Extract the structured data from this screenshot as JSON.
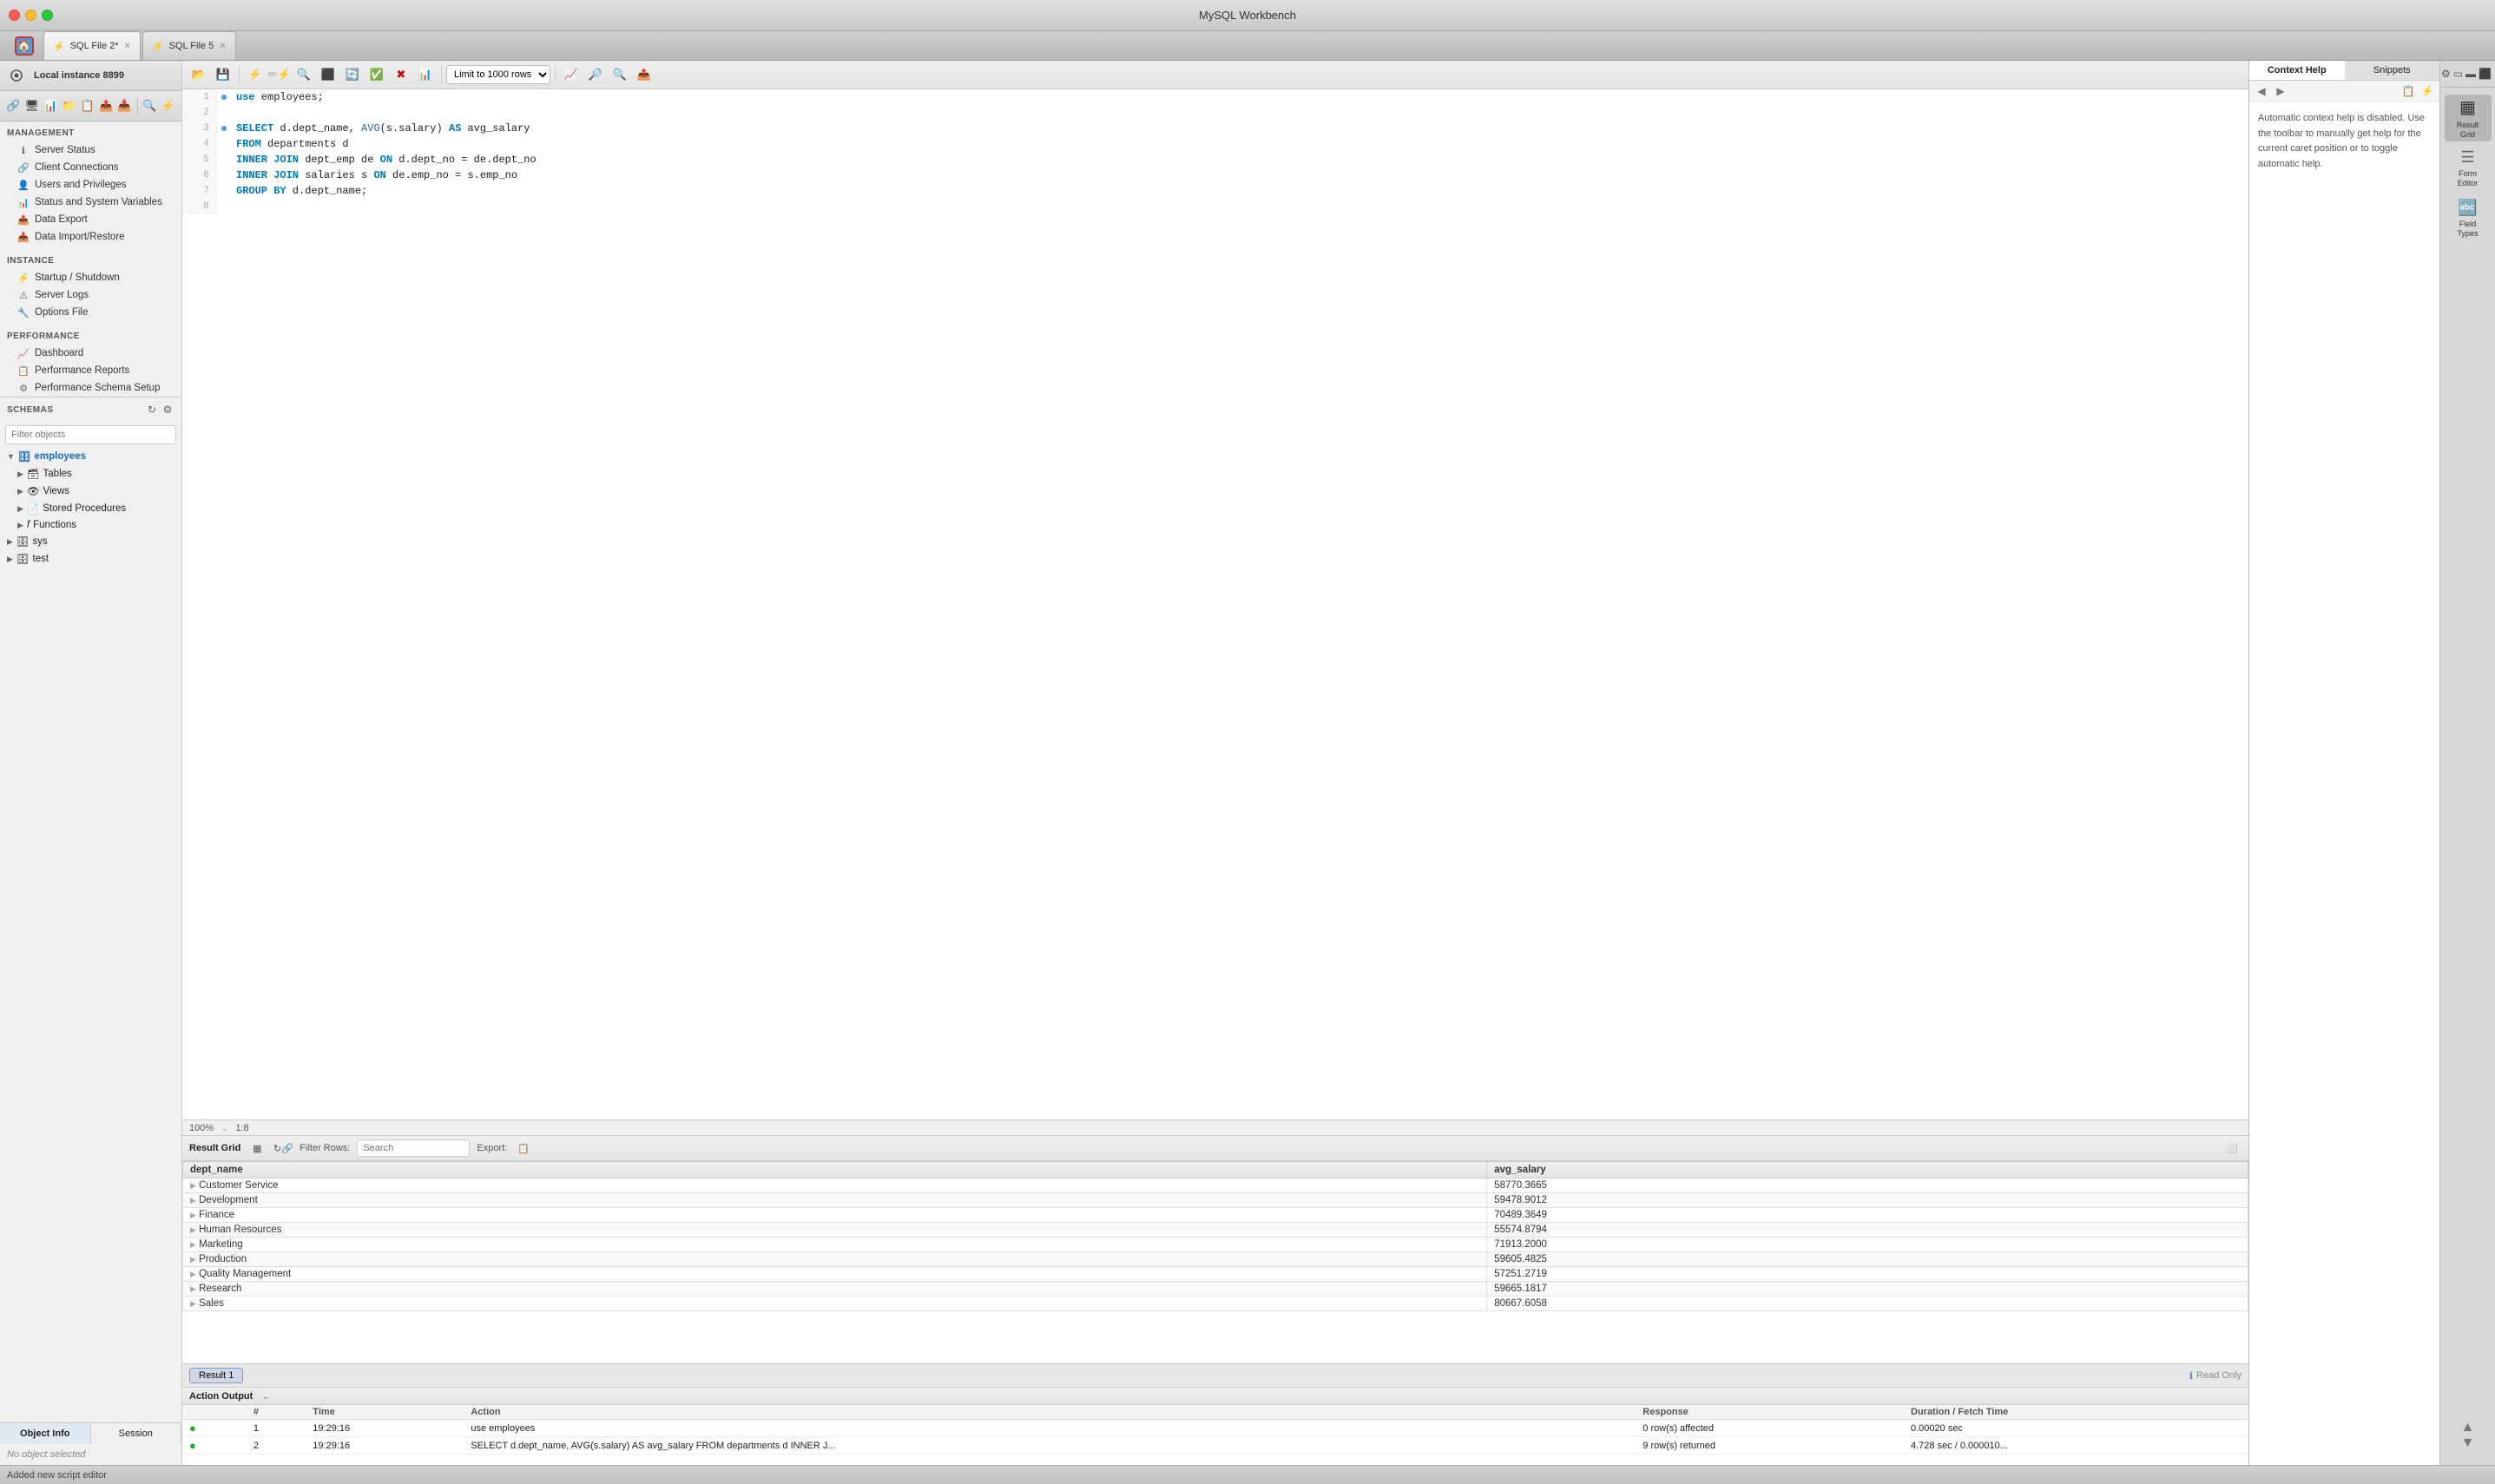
{
  "app": {
    "title": "MySQL Workbench"
  },
  "titlebar": {
    "title": "MySQL Workbench"
  },
  "tabs": {
    "home": "🏠",
    "items": [
      {
        "label": "SQL File 2*",
        "active": true,
        "icon": "⚡"
      },
      {
        "label": "SQL File 5",
        "active": false,
        "icon": "⚡"
      }
    ]
  },
  "toolbar": {
    "buttons": [
      "📁",
      "💾",
      "⚡",
      "✏️",
      "🔍",
      "🔴",
      "📋",
      "✅",
      "✖️",
      "📊"
    ],
    "limit_select": "Limit to 1000 rows"
  },
  "sidebar": {
    "management_title": "MANAGEMENT",
    "management_items": [
      {
        "label": "Server Status",
        "icon": "ℹ"
      },
      {
        "label": "Client Connections",
        "icon": "🔗"
      },
      {
        "label": "Users and Privileges",
        "icon": "👤"
      },
      {
        "label": "Status and System Variables",
        "icon": "📊"
      },
      {
        "label": "Data Export",
        "icon": "📤"
      },
      {
        "label": "Data Import/Restore",
        "icon": "📥"
      }
    ],
    "instance_title": "INSTANCE",
    "instance_items": [
      {
        "label": "Startup / Shutdown",
        "icon": "⚡"
      },
      {
        "label": "Server Logs",
        "icon": "⚠"
      },
      {
        "label": "Options File",
        "icon": "🔧"
      }
    ],
    "performance_title": "PERFORMANCE",
    "performance_items": [
      {
        "label": "Dashboard",
        "icon": "📈"
      },
      {
        "label": "Performance Reports",
        "icon": "📋"
      },
      {
        "label": "Performance Schema Setup",
        "icon": "⚙"
      }
    ],
    "schemas_title": "SCHEMAS",
    "filter_placeholder": "Filter objects",
    "schemas": [
      {
        "name": "employees",
        "active": true,
        "expanded": true,
        "children": [
          {
            "name": "Tables",
            "icon": "🗃",
            "expanded": false
          },
          {
            "name": "Views",
            "icon": "👁",
            "expanded": false
          },
          {
            "name": "Stored Procedures",
            "icon": "📄",
            "expanded": false
          },
          {
            "name": "Functions",
            "icon": "𝑓",
            "expanded": false
          }
        ]
      },
      {
        "name": "sys",
        "active": false,
        "expanded": false
      },
      {
        "name": "test",
        "active": false,
        "expanded": false
      }
    ]
  },
  "bottom_tabs": [
    "Object Info",
    "Session"
  ],
  "no_object_label": "No object selected",
  "sql_editor": {
    "zoom": "100%",
    "caret_pos": "1:8",
    "lines": [
      {
        "num": 1,
        "dot": true,
        "content": "use employees;"
      },
      {
        "num": 2,
        "dot": false,
        "content": ""
      },
      {
        "num": 3,
        "dot": true,
        "content_parts": [
          {
            "type": "kw",
            "text": "SELECT "
          },
          {
            "type": "plain",
            "text": "d.dept_name, "
          },
          {
            "type": "fn",
            "text": "AVG"
          },
          {
            "type": "plain",
            "text": "(s.salary) "
          },
          {
            "type": "kw",
            "text": "AS"
          },
          {
            "type": "plain",
            "text": " avg_salary"
          }
        ]
      },
      {
        "num": 4,
        "dot": false,
        "content_parts": [
          {
            "type": "kw",
            "text": "FROM"
          },
          {
            "type": "plain",
            "text": " departments d"
          }
        ]
      },
      {
        "num": 5,
        "dot": false,
        "content_parts": [
          {
            "type": "kw",
            "text": "INNER JOIN"
          },
          {
            "type": "plain",
            "text": " dept_emp de "
          },
          {
            "type": "kw",
            "text": "ON"
          },
          {
            "type": "plain",
            "text": " d.dept_no = de.dept_no"
          }
        ]
      },
      {
        "num": 6,
        "dot": false,
        "content_parts": [
          {
            "type": "kw",
            "text": "INNER JOIN"
          },
          {
            "type": "plain",
            "text": " salaries s "
          },
          {
            "type": "kw",
            "text": "ON"
          },
          {
            "type": "plain",
            "text": " de.emp_no = s.emp_no"
          }
        ]
      },
      {
        "num": 7,
        "dot": false,
        "content_parts": [
          {
            "type": "kw",
            "text": "GROUP BY"
          },
          {
            "type": "plain",
            "text": " d.dept_name;"
          }
        ]
      },
      {
        "num": 8,
        "dot": false,
        "content": ""
      }
    ]
  },
  "results": {
    "columns": [
      "dept_name",
      "avg_salary"
    ],
    "rows": [
      {
        "dept_name": "Customer Service",
        "avg_salary": "58770.3665"
      },
      {
        "dept_name": "Development",
        "avg_salary": "59478.9012"
      },
      {
        "dept_name": "Finance",
        "avg_salary": "70489.3649"
      },
      {
        "dept_name": "Human Resources",
        "avg_salary": "55574.8794"
      },
      {
        "dept_name": "Marketing",
        "avg_salary": "71913.2000"
      },
      {
        "dept_name": "Production",
        "avg_salary": "59605.4825"
      },
      {
        "dept_name": "Quality Management",
        "avg_salary": "57251.2719"
      },
      {
        "dept_name": "Research",
        "avg_salary": "59665.1817"
      },
      {
        "dept_name": "Sales",
        "avg_salary": "80667.6058"
      }
    ],
    "tab_label": "Result 1",
    "read_only_label": "Read Only",
    "filter_label": "Filter Rows:",
    "filter_placeholder": "Search",
    "export_label": "Export:"
  },
  "action_output": {
    "title": "Action Output",
    "columns": [
      "",
      "Time",
      "Action",
      "Response",
      "Duration / Fetch Time"
    ],
    "rows": [
      {
        "num": "1",
        "time": "19:29:16",
        "action": "use employees",
        "response": "0 row(s) affected",
        "duration": "0.00020 sec"
      },
      {
        "num": "2",
        "time": "19:29:16",
        "action": "SELECT d.dept_name, AVG(s.salary) AS avg_salary FROM departments d INNER J...",
        "response": "9 row(s) returned",
        "duration": "4.728 sec / 0.000010..."
      }
    ]
  },
  "tab_instance": "Local instance 8899",
  "help_panel": {
    "tabs": [
      "Context Help",
      "Snippets"
    ],
    "active_tab": "Context Help",
    "nav_prev": "◀",
    "nav_next": "▶",
    "text": "Automatic context help is disabled. Use the toolbar to manually get help for the current caret position or to toggle automatic help."
  },
  "right_panel": {
    "buttons": [
      {
        "label": "Result\nGrid",
        "active": true
      },
      {
        "label": "Form\nEditor",
        "active": false
      },
      {
        "label": "Field\nTypes",
        "active": false
      }
    ]
  },
  "status_bar": {
    "text": "Added new script editor"
  }
}
